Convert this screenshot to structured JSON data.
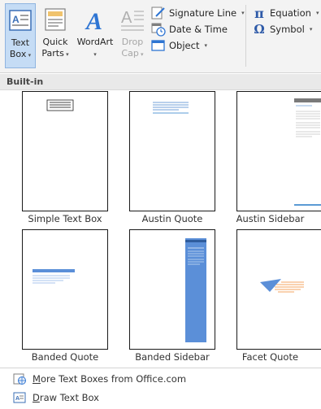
{
  "ribbon": {
    "text_box": {
      "label_line1": "Text",
      "label_line2": "Box"
    },
    "quick_parts": {
      "label_line1": "Quick",
      "label_line2": "Parts"
    },
    "wordart": {
      "label": "WordArt"
    },
    "drop_cap": {
      "label_line1": "Drop",
      "label_line2": "Cap"
    },
    "signature_line": {
      "label": "Signature Line"
    },
    "date_time": {
      "label": "Date & Time"
    },
    "object": {
      "label": "Object"
    },
    "equation": {
      "label": "Equation"
    },
    "symbol": {
      "label": "Symbol"
    }
  },
  "gallery": {
    "section_title": "Built-in",
    "items": [
      {
        "label": "Simple Text Box"
      },
      {
        "label": "Austin Quote"
      },
      {
        "label": "Austin Sidebar"
      },
      {
        "label": "Banded Quote"
      },
      {
        "label": "Banded Sidebar"
      },
      {
        "label": "Facet Quote"
      }
    ]
  },
  "menu": {
    "more_text_boxes": {
      "mnemonic": "M",
      "rest": "ore Text Boxes from Office.com"
    },
    "draw_text_box": {
      "mnemonic": "D",
      "rest": "raw Text Box"
    }
  },
  "colors": {
    "accent_blue": "#5b9bd5",
    "banded_blue": "#5b8fd8",
    "facet_orange": "#f4a460",
    "selected_bg": "#c5dcf5"
  }
}
